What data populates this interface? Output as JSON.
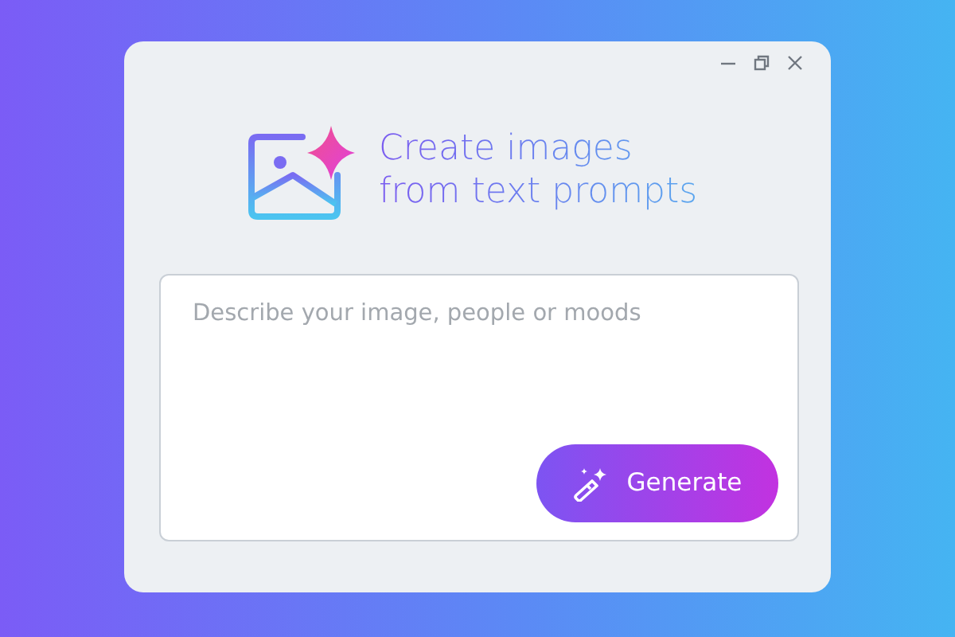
{
  "headline": [
    "Create images",
    "from text prompts"
  ],
  "prompt": {
    "placeholder": "Describe your image, people or moods"
  },
  "button": {
    "label": "Generate"
  }
}
